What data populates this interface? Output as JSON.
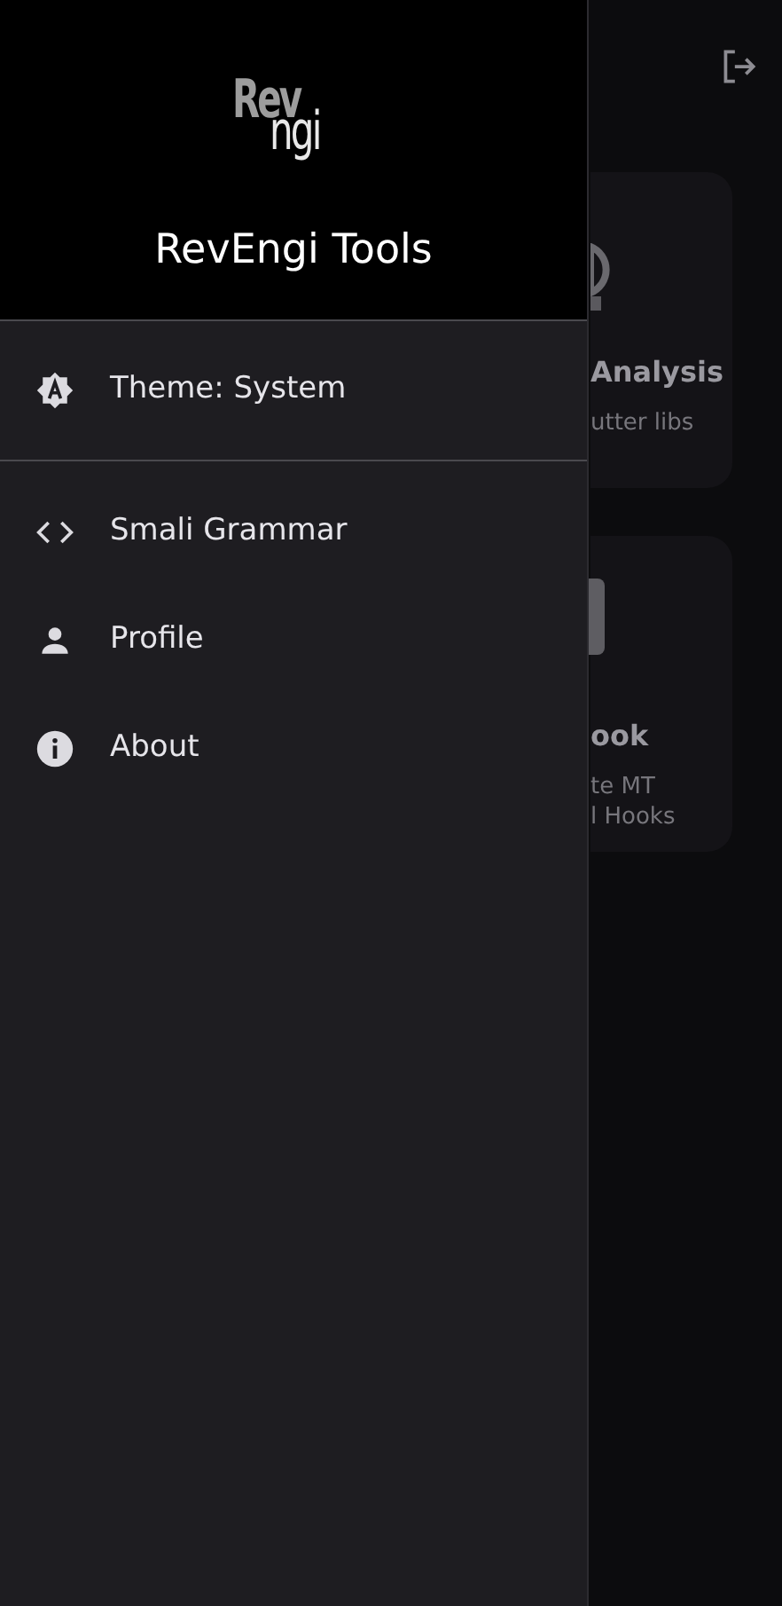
{
  "drawer": {
    "logo": [
      "Rev",
      "ngi"
    ],
    "title": "RevEngi Tools",
    "setting": {
      "label": "Theme: System"
    },
    "items": [
      {
        "label": "Smali Grammar"
      },
      {
        "label": "Profile"
      },
      {
        "label": "About"
      }
    ]
  },
  "background": {
    "cards": [
      {
        "title": "Analysis",
        "lines": [
          "utter libs"
        ],
        "kind": "round"
      },
      {
        "title": "ook",
        "lines": [
          "te MT",
          "l Hooks"
        ],
        "kind": "square"
      }
    ]
  }
}
